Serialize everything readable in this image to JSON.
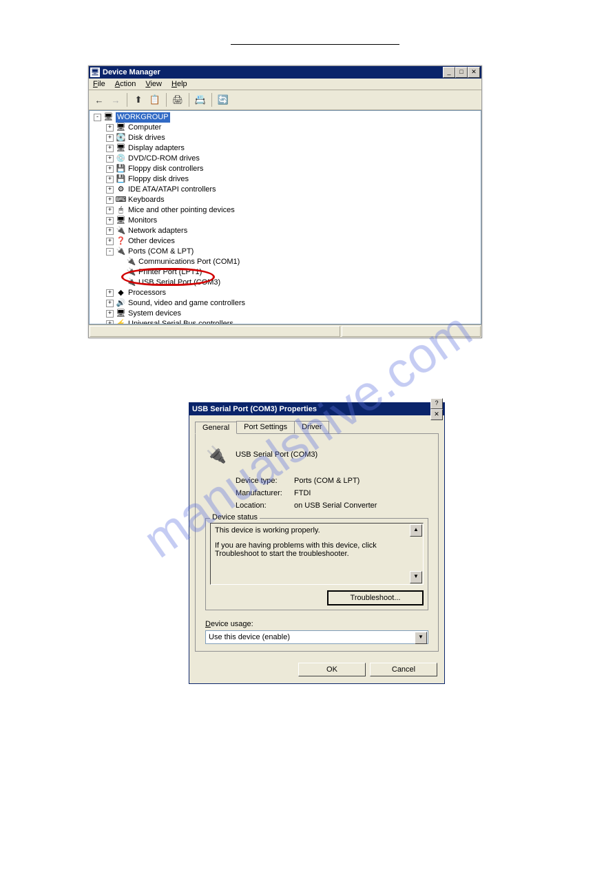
{
  "watermark": "manualshive.com",
  "devmgr": {
    "title": "Device Manager",
    "menus": {
      "file": "File",
      "action": "Action",
      "view": "View",
      "help": "Help"
    },
    "tree": {
      "root": "WORKGROUP",
      "items": [
        "Computer",
        "Disk drives",
        "Display adapters",
        "DVD/CD-ROM drives",
        "Floppy disk controllers",
        "Floppy disk drives",
        "IDE ATA/ATAPI controllers",
        "Keyboards",
        "Mice and other pointing devices",
        "Monitors",
        "Network adapters",
        "Other devices",
        "Ports (COM & LPT)",
        "Processors",
        "Sound, video and game controllers",
        "System devices",
        "Universal Serial Bus controllers"
      ],
      "ports_children": [
        "Communications Port (COM1)",
        "Printer Port (LPT1)",
        "USB Serial Port (COM3)"
      ]
    }
  },
  "props": {
    "title": "USB Serial Port (COM3) Properties",
    "tabs": {
      "general": "General",
      "port": "Port Settings",
      "driver": "Driver"
    },
    "device_name": "USB Serial Port (COM3)",
    "rows": {
      "type_k": "Device type:",
      "type_v": "Ports (COM & LPT)",
      "mfr_k": "Manufacturer:",
      "mfr_v": "FTDI",
      "loc_k": "Location:",
      "loc_v": "on USB Serial Converter"
    },
    "status_legend": "Device status",
    "status_text1": "This device is working properly.",
    "status_text2": "If you are having problems with this device, click Troubleshoot to start the troubleshooter.",
    "troubleshoot": "Troubleshoot...",
    "usage_lbl": "Device usage:",
    "usage_val": "Use this device (enable)",
    "ok": "OK",
    "cancel": "Cancel"
  }
}
